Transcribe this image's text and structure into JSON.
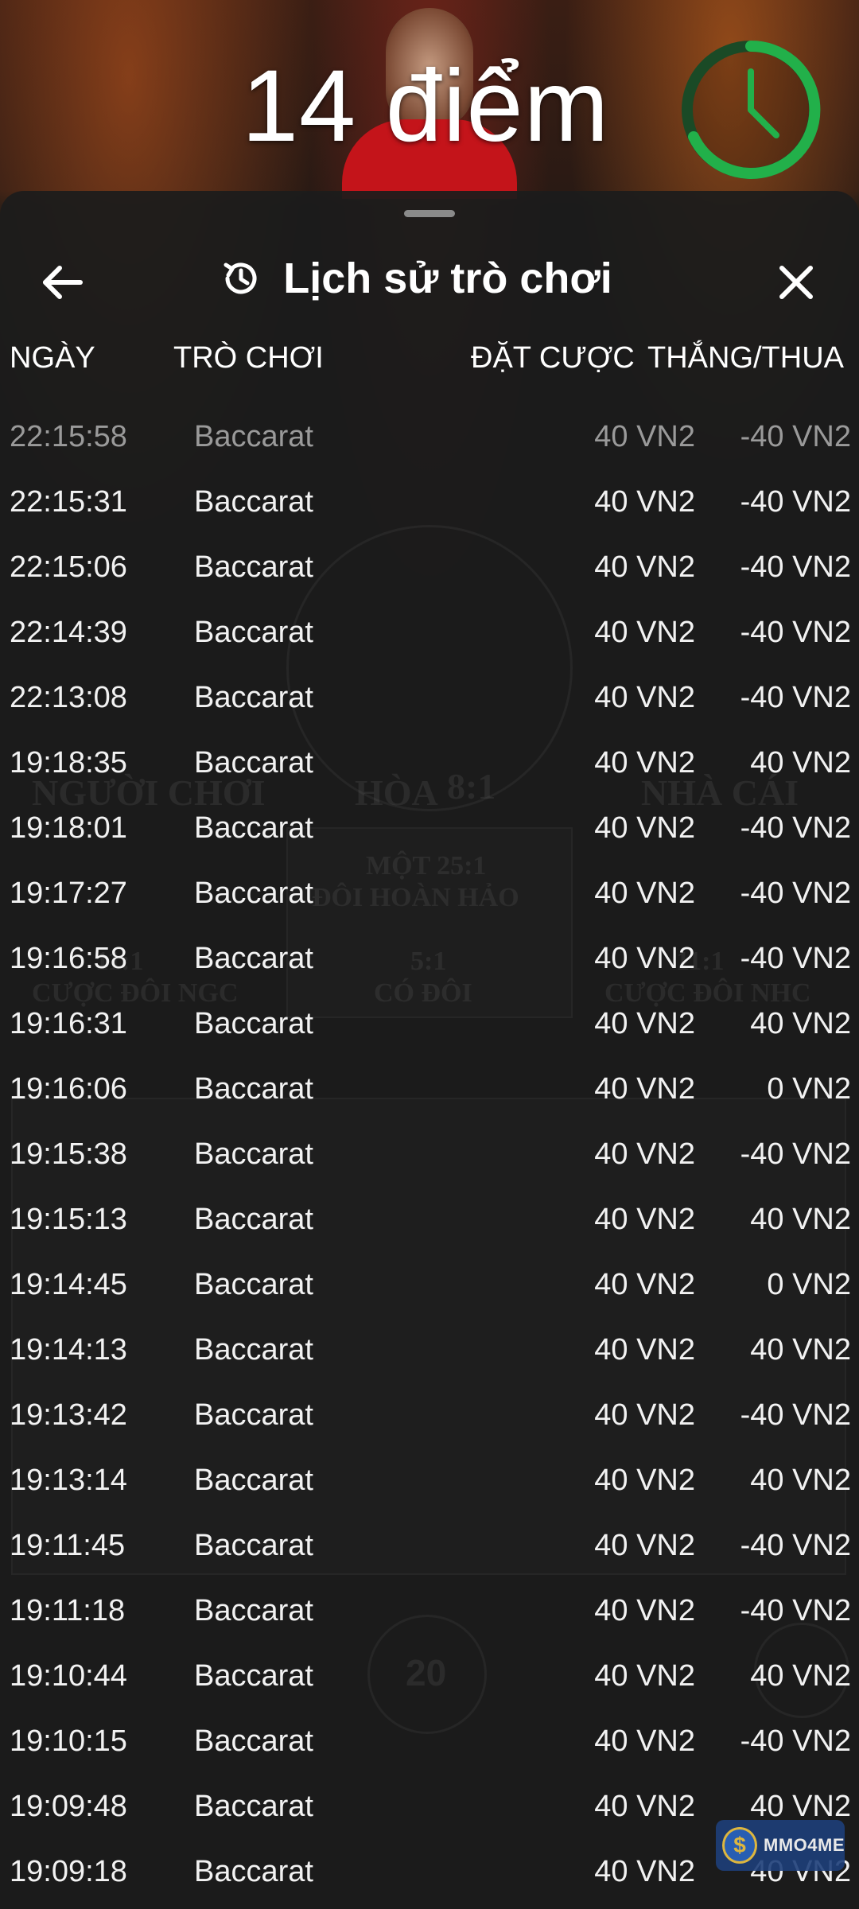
{
  "game": {
    "score_text": "14 điểm"
  },
  "panel": {
    "title": "Lịch sử trò chơi"
  },
  "columns": {
    "date": "NGÀY",
    "game": "TRÒ CHƠI",
    "bet": "ĐẶT CƯỢC",
    "result": "THẮNG/THUA"
  },
  "rows": [
    {
      "date": "22:15:58",
      "game": "Baccarat",
      "bet": "40 VN2",
      "result": "-40 VN2"
    },
    {
      "date": "22:15:31",
      "game": "Baccarat",
      "bet": "40 VN2",
      "result": "-40 VN2"
    },
    {
      "date": "22:15:06",
      "game": "Baccarat",
      "bet": "40 VN2",
      "result": "-40 VN2"
    },
    {
      "date": "22:14:39",
      "game": "Baccarat",
      "bet": "40 VN2",
      "result": "-40 VN2"
    },
    {
      "date": "22:13:08",
      "game": "Baccarat",
      "bet": "40 VN2",
      "result": "-40 VN2"
    },
    {
      "date": "19:18:35",
      "game": "Baccarat",
      "bet": "40 VN2",
      "result": "40 VN2"
    },
    {
      "date": "19:18:01",
      "game": "Baccarat",
      "bet": "40 VN2",
      "result": "-40 VN2"
    },
    {
      "date": "19:17:27",
      "game": "Baccarat",
      "bet": "40 VN2",
      "result": "-40 VN2"
    },
    {
      "date": "19:16:58",
      "game": "Baccarat",
      "bet": "40 VN2",
      "result": "-40 VN2"
    },
    {
      "date": "19:16:31",
      "game": "Baccarat",
      "bet": "40 VN2",
      "result": "40 VN2"
    },
    {
      "date": "19:16:06",
      "game": "Baccarat",
      "bet": "40 VN2",
      "result": "0 VN2"
    },
    {
      "date": "19:15:38",
      "game": "Baccarat",
      "bet": "40 VN2",
      "result": "-40 VN2"
    },
    {
      "date": "19:15:13",
      "game": "Baccarat",
      "bet": "40 VN2",
      "result": "40 VN2"
    },
    {
      "date": "19:14:45",
      "game": "Baccarat",
      "bet": "40 VN2",
      "result": "0 VN2"
    },
    {
      "date": "19:14:13",
      "game": "Baccarat",
      "bet": "40 VN2",
      "result": "40 VN2"
    },
    {
      "date": "19:13:42",
      "game": "Baccarat",
      "bet": "40 VN2",
      "result": "-40 VN2"
    },
    {
      "date": "19:13:14",
      "game": "Baccarat",
      "bet": "40 VN2",
      "result": "40 VN2"
    },
    {
      "date": "19:11:45",
      "game": "Baccarat",
      "bet": "40 VN2",
      "result": "-40 VN2"
    },
    {
      "date": "19:11:18",
      "game": "Baccarat",
      "bet": "40 VN2",
      "result": "-40 VN2"
    },
    {
      "date": "19:10:44",
      "game": "Baccarat",
      "bet": "40 VN2",
      "result": "40 VN2"
    },
    {
      "date": "19:10:15",
      "game": "Baccarat",
      "bet": "40 VN2",
      "result": "-40 VN2"
    },
    {
      "date": "19:09:48",
      "game": "Baccarat",
      "bet": "40 VN2",
      "result": "40 VN2"
    },
    {
      "date": "19:09:18",
      "game": "Baccarat",
      "bet": "40 VN2",
      "result": "40 VN2"
    }
  ],
  "background_labels": {
    "player": "NGƯỜI CHƠI",
    "tie": "HÒA",
    "tie_odds": "8:1",
    "banker": "NHÀ CÁI",
    "perfect_pair_odds": "MỘT 25:1",
    "perfect_pair": "ĐÔI HOÀN HẢO",
    "player_pair_odds": "11:1",
    "player_pair": "CƯỢC ĐÔI NGC",
    "either_pair_odds": "5:1",
    "either_pair": "CÓ ĐÔI",
    "banker_pair_odds": "11:1",
    "banker_pair": "CƯỢC ĐÔI NHC",
    "chip_value": "20"
  },
  "watermark": {
    "brand": "MMO4ME"
  },
  "colors": {
    "timer_green": "#22b04a",
    "sheet_bg": "#1c1c1c",
    "dealer_shirt": "#c4141a"
  },
  "icons": {
    "back": "arrow-left-icon",
    "history": "history-clock-icon",
    "close": "close-icon",
    "timer": "countdown-timer-icon"
  }
}
